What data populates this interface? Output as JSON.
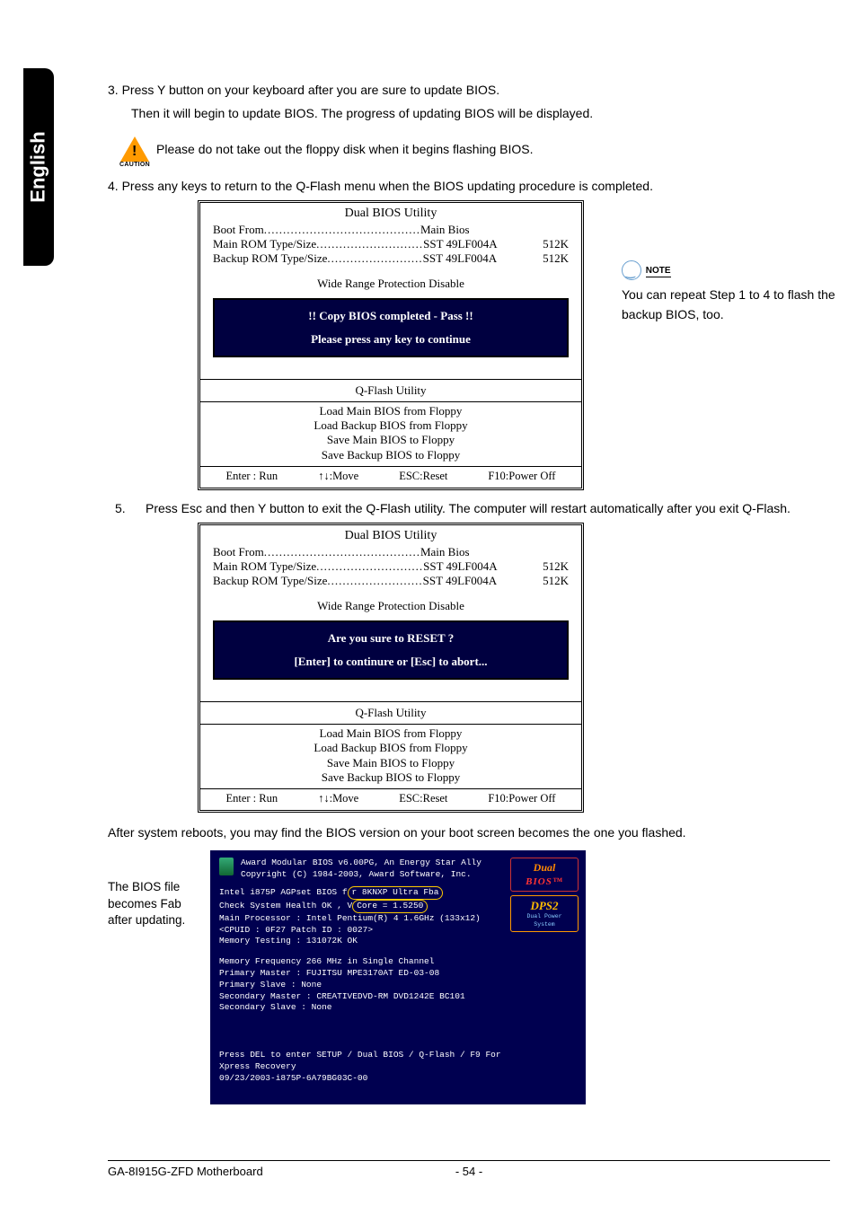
{
  "sideTab": "English",
  "step3": {
    "line1": "3. Press Y button on your keyboard after you are sure to update BIOS.",
    "line2": "Then it will begin to update BIOS. The progress of updating BIOS will be displayed."
  },
  "caution": {
    "label": "CAUTION",
    "text": "Please do not take out the floppy disk when it begins flashing BIOS."
  },
  "step4": "4. Press any keys to return to the Q-Flash menu when the BIOS updating procedure is completed.",
  "bios1": {
    "title": "Dual BIOS Utility",
    "bootFromLabel": "Boot From",
    "bootFromVal": "Main Bios",
    "mainRomLabel": "Main ROM Type/Size",
    "mainRomVal": "SST 49LF004A",
    "mainRomSize": "512K",
    "backupRomLabel": "Backup ROM Type/Size",
    "backupRomVal": "SST 49LF004A",
    "backupRomSize": "512K",
    "wide": "Wide Range Protection     Disable",
    "popupLine1": "!! Copy BIOS completed - Pass !!",
    "popupLine2": "Please press any key to continue",
    "qflash": "Q-Flash Utility",
    "menu": [
      "Load Main BIOS from Floppy",
      "Load Backup BIOS from Floppy",
      "Save Main BIOS to Floppy",
      "Save Backup BIOS to Floppy"
    ],
    "footer": [
      "Enter : Run",
      "↑↓:Move",
      "ESC:Reset",
      "F10:Power Off"
    ]
  },
  "noteSide": {
    "label": "NOTE",
    "text": "You can repeat Step 1 to 4 to flash the backup BIOS, too."
  },
  "step5": {
    "num": "5.",
    "text": "Press Esc and then Y button to exit the Q-Flash utility. The computer will restart automatically after you exit Q-Flash."
  },
  "bios2": {
    "title": "Dual BIOS Utility",
    "bootFromLabel": "Boot From",
    "bootFromVal": "Main Bios",
    "mainRomLabel": "Main ROM Type/Size",
    "mainRomVal": "SST 49LF004A",
    "mainRomSize": "512K",
    "backupRomLabel": "Backup ROM Type/Size",
    "backupRomVal": "SST 49LF004A",
    "backupRomSize": "512K",
    "wide": "Wide Range Protection     Disable",
    "popupLine1": "Are you sure to RESET ?",
    "popupLine2": "[Enter] to continure or [Esc] to abort...",
    "qflash": "Q-Flash Utility",
    "menu": [
      "Load Main BIOS from Floppy",
      "Load Backup BIOS from Floppy",
      "Save Main BIOS to Floppy",
      "Save Backup BIOS to Floppy"
    ],
    "footer": [
      "Enter : Run",
      "↑↓:Move",
      "ESC:Reset",
      "F10:Power Off"
    ]
  },
  "afterReboot": "After system reboots, you may find the BIOS version on your boot screen becomes the one you flashed.",
  "bootNote": "The BIOS file becomes Fab after updating.",
  "boot": {
    "hdr1": "Award Modular BIOS v6.00PG, An Energy Star Ally",
    "hdr2": "Copyright  (C) 1984-2003, Award Software,  Inc.",
    "l1a": "Intel i875P AGPset BIOS f",
    "l1b": "r 8KNXP Ultra Fba",
    "l2a": "Check System Health OK , V",
    "l2b": "Core = 1.5250",
    "l3": "Main Processor : Intel Pentium(R) 4   1.6GHz (133x12)",
    "l4": "<CPUID : 0F27 Patch ID  : 0027>",
    "l5": "Memory Testing   : 131072K OK",
    "l6": "Memory Frequency 266 MHz in Single Channel",
    "l7": "Primary Master : FUJITSU MPE3170AT ED-03-08",
    "l8": "Primary Slave : None",
    "l9": "Secondary Master : CREATIVEDVD-RM DVD1242E BC101",
    "l10": "Secondary Slave : None",
    "l11": "Press DEL to enter SETUP / Dual BIOS / Q-Flash / F9 For",
    "l12": "Xpress Recovery",
    "l13": "09/23/2003-i875P-6A79BG03C-00",
    "dualLogo": "Dual",
    "dualBios": "BIOS™",
    "dps": "DPS2",
    "dpsSub": "Dual Power System"
  },
  "footer": {
    "left": "GA-8I915G-ZFD Motherboard",
    "page": "- 54 -"
  }
}
